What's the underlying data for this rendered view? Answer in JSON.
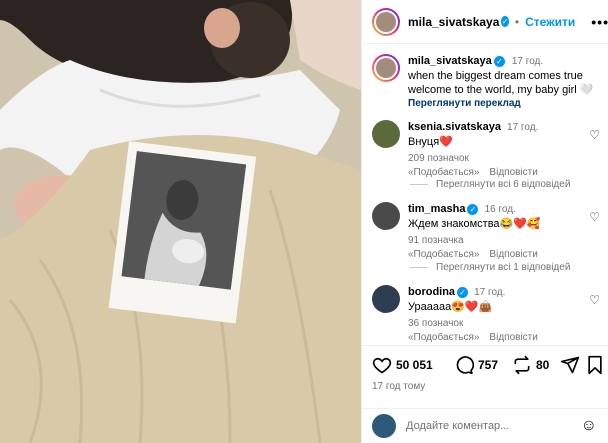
{
  "post": {
    "author": "mila_sivatskaya",
    "follow_label": "Стежити",
    "more_label": "•••",
    "caption": {
      "username": "mila_sivatskaya",
      "time": "17 год.",
      "line1": "when the biggest dream comes true",
      "line2": "welcome to the world, my baby girl 🤍",
      "translate": "Переглянути переклад"
    },
    "likes_count": "50 051",
    "comments_count": "757",
    "shares_count": "80",
    "posted_ago": "17 год тому",
    "add_comment_placeholder": "Додайте коментар..."
  },
  "comments": [
    {
      "username": "ksenia.sivatskaya",
      "time": "17 год.",
      "verified": false,
      "text": "Внуця❤️",
      "likes": "209 позначок «Подобається»",
      "reply": "Відповісти",
      "view_replies": "Переглянути всі 6 відповідей"
    },
    {
      "username": "tim_masha",
      "time": "16 год.",
      "verified": true,
      "text": "Ждем знакомства😂❤️🥰",
      "likes": "91 позначка «Подобається»",
      "reply": "Відповісти",
      "view_replies": "Переглянути всі 1 відповідей"
    },
    {
      "username": "borodina",
      "time": "17 год.",
      "verified": true,
      "text": "Урааааа😍❤️👜",
      "likes": "36 позначок «Подобається»",
      "reply": "Відповісти"
    }
  ],
  "icons": {
    "verified": "✓"
  },
  "colors": {
    "accent": "#0095f6",
    "muted": "#737373",
    "link": "#00376b"
  }
}
